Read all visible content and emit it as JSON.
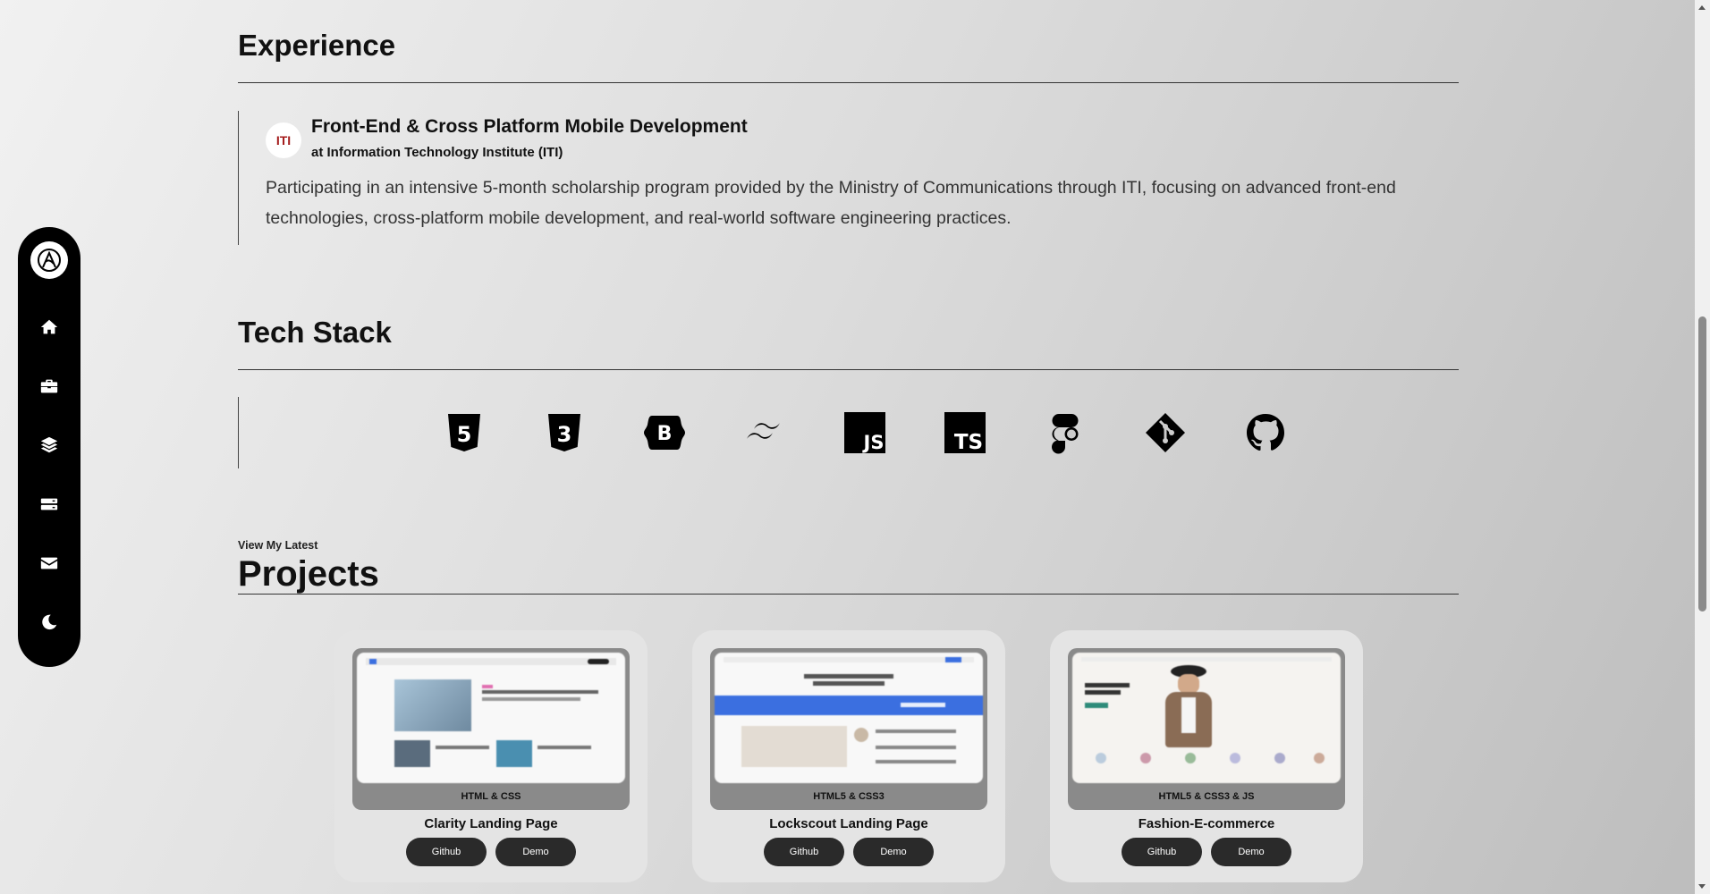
{
  "sidebar": {
    "items": [
      {
        "icon": "home-icon",
        "name": "nav-home"
      },
      {
        "icon": "briefcase-icon",
        "name": "nav-experience"
      },
      {
        "icon": "layers-icon",
        "name": "nav-stack"
      },
      {
        "icon": "server-icon",
        "name": "nav-projects"
      },
      {
        "icon": "envelope-icon",
        "name": "nav-contact"
      },
      {
        "icon": "moon-icon",
        "name": "theme-toggle"
      }
    ]
  },
  "experience": {
    "heading": "Experience",
    "item": {
      "logo_text": "ITI",
      "title": "Front-End & Cross Platform Mobile Development",
      "company": "at Information Technology Institute (ITI)",
      "description": "Participating in an intensive 5-month scholarship program provided by the Ministry of Communications through ITI, focusing on advanced front-end technologies, cross-platform mobile development, and real-world software engineering practices."
    }
  },
  "tech_stack": {
    "heading": "Tech Stack",
    "icons": [
      "html5-icon",
      "css3-icon",
      "bootstrap-icon",
      "tailwind-icon",
      "javascript-icon",
      "typescript-icon",
      "figma-icon",
      "git-icon",
      "github-icon"
    ],
    "html_label": "5",
    "css_label": "3",
    "bootstrap_label": "B",
    "js_label": "JS",
    "ts_label": "TS"
  },
  "projects": {
    "pre_heading": "View My Latest",
    "heading": "Projects",
    "cards": [
      {
        "tag": "HTML & CSS",
        "title": "Clarity Landing Page",
        "github": "Github",
        "demo": "Demo"
      },
      {
        "tag": "HTML5 & CSS3",
        "title": "Lockscout Landing Page",
        "github": "Github",
        "demo": "Demo"
      },
      {
        "tag": "HTML5 & CSS3 & JS",
        "title": "Fashion-E-commerce",
        "github": "Github",
        "demo": "Demo"
      }
    ]
  },
  "colors": {
    "accent_blue": "#3b6fe0",
    "sidebar_bg": "#000000",
    "button_bg": "#2a2a2a"
  }
}
